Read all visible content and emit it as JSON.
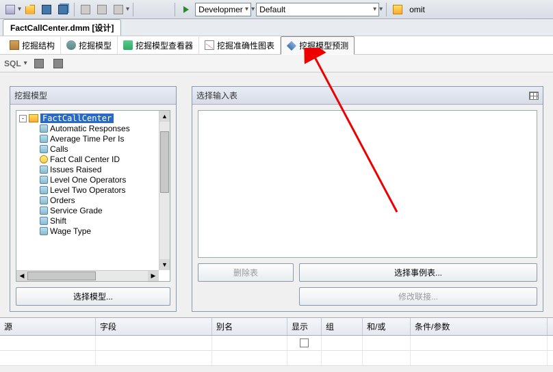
{
  "top_toolbar": {
    "config_dropdown": "Developmer",
    "target_dropdown": "Default",
    "omit_label": "omit"
  },
  "doc_tab": {
    "title": "FactCallCenter.dmm [设计]"
  },
  "inner_tabs": [
    {
      "label": "挖掘结构"
    },
    {
      "label": "挖掘模型"
    },
    {
      "label": "挖掘模型查看器"
    },
    {
      "label": "挖掘准确性图表"
    },
    {
      "label": "挖掘模型预测"
    }
  ],
  "sql_bar": {
    "label": "SQL"
  },
  "left_panel": {
    "title": "挖掘模型",
    "toggle": "-",
    "root": "FactCallCenter",
    "items": [
      {
        "label": "Automatic Responses",
        "type": "attr"
      },
      {
        "label": "Average Time Per Is",
        "type": "attr"
      },
      {
        "label": "Calls",
        "type": "attr"
      },
      {
        "label": "Fact Call Center ID",
        "type": "key"
      },
      {
        "label": "Issues Raised",
        "type": "attr"
      },
      {
        "label": "Level One Operators",
        "type": "attr"
      },
      {
        "label": "Level Two Operators",
        "type": "attr"
      },
      {
        "label": "Orders",
        "type": "attr"
      },
      {
        "label": "Service Grade",
        "type": "attr"
      },
      {
        "label": "Shift",
        "type": "attr"
      },
      {
        "label": "Wage Type",
        "type": "attr"
      }
    ],
    "select_btn": "选择模型..."
  },
  "right_panel": {
    "title": "选择输入表",
    "delete_btn": "删除表",
    "select_case_btn": "选择事例表...",
    "modify_join_btn": "修改联接..."
  },
  "grid": {
    "headers": [
      "源",
      "字段",
      "别名",
      "显示",
      "组",
      "和/或",
      "条件/参数"
    ]
  }
}
